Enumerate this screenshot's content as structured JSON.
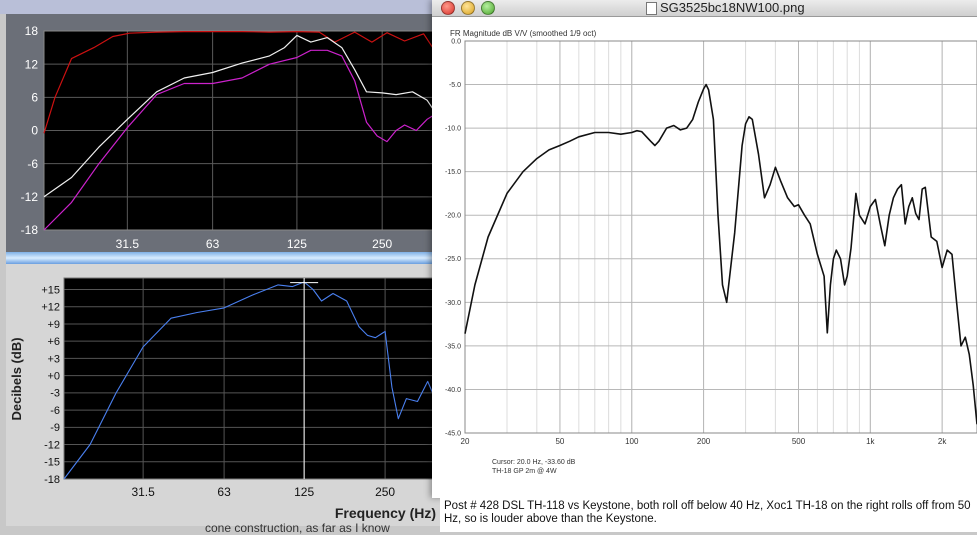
{
  "window": {
    "title": "SG3525bc18NW100.png"
  },
  "caption": "Post # 428 DSL TH-118 vs Keystone, both roll off below 40 Hz, Xoc1 TH-18 on the right rolls off from 50 Hz, so is louder above than the Keystone.",
  "cutoff_text": "cone construction, as far as I know",
  "chart_data": [
    {
      "type": "line",
      "title": "",
      "x_scale": "log",
      "xlim": [
        16,
        400
      ],
      "ylim": [
        -18,
        18
      ],
      "x_ticks": [
        {
          "v": 31.5,
          "label": "31.5"
        },
        {
          "v": 63,
          "label": "63"
        },
        {
          "v": 125,
          "label": "125"
        },
        {
          "v": 250,
          "label": "250"
        }
      ],
      "y_ticks": [
        {
          "v": 18,
          "label": "18"
        },
        {
          "v": 12,
          "label": "12"
        },
        {
          "v": 6,
          "label": "6"
        },
        {
          "v": 0,
          "label": "0"
        },
        {
          "v": -6,
          "label": "-6"
        },
        {
          "v": -12,
          "label": "-12"
        },
        {
          "v": -18,
          "label": "-18"
        }
      ],
      "colors": {
        "red": "#cc1111",
        "white": "#f0f0f0",
        "magenta": "#cc22cc"
      },
      "series": [
        {
          "color": "red",
          "x": [
            16,
            17.5,
            20,
            24,
            28,
            32,
            40,
            50,
            63,
            80,
            100,
            125,
            150,
            170,
            200,
            230,
            260,
            300,
            350,
            400
          ],
          "y": [
            -0.5,
            6,
            13,
            15,
            17,
            17.6,
            17.8,
            17.9,
            17.9,
            17.9,
            17.8,
            17.9,
            17.8,
            16,
            17.8,
            16,
            17.7,
            16.2,
            17.5,
            13
          ]
        },
        {
          "color": "white",
          "x": [
            16,
            20,
            25,
            31.5,
            40,
            50,
            63,
            80,
            100,
            113,
            125,
            140,
            160,
            180,
            200,
            220,
            250,
            280,
            320,
            360,
            400
          ],
          "y": [
            -12,
            -8.5,
            -3,
            2,
            7,
            9.5,
            10.5,
            12.2,
            13.5,
            15,
            17.2,
            16,
            16.8,
            15,
            11,
            7,
            6.8,
            6.5,
            7,
            5.5,
            2
          ]
        },
        {
          "color": "magenta",
          "x": [
            16,
            20,
            25,
            31.5,
            40,
            50,
            63,
            80,
            100,
            125,
            140,
            160,
            180,
            200,
            220,
            240,
            260,
            280,
            300,
            330,
            360,
            400
          ],
          "y": [
            -18,
            -13,
            -6,
            0.5,
            6.5,
            8.5,
            8.5,
            9.5,
            12,
            13.2,
            14.5,
            14.5,
            13.5,
            9,
            1.5,
            -1,
            -2,
            0,
            1,
            0,
            2,
            3.5
          ]
        }
      ]
    },
    {
      "type": "line",
      "title": "",
      "ylabel": "Decibels (dB)",
      "xlabel": "Frequency (Hz)",
      "x_scale": "log",
      "xlim": [
        16,
        400
      ],
      "ylim": [
        -18,
        17
      ],
      "x_ticks": [
        {
          "v": 31.5,
          "label": "31.5"
        },
        {
          "v": 63,
          "label": "63"
        },
        {
          "v": 125,
          "label": "125"
        },
        {
          "v": 250,
          "label": "250"
        }
      ],
      "y_ticks": [
        {
          "v": 15,
          "label": "+15"
        },
        {
          "v": 12,
          "label": "+12"
        },
        {
          "v": 9,
          "label": "+9"
        },
        {
          "v": 6,
          "label": "+6"
        },
        {
          "v": 3,
          "label": "+3"
        },
        {
          "v": 0,
          "label": "+0"
        },
        {
          "v": -3,
          "label": "-3"
        },
        {
          "v": -6,
          "label": "-6"
        },
        {
          "v": -9,
          "label": "-9"
        },
        {
          "v": -12,
          "label": "-12"
        },
        {
          "v": -15,
          "label": "-15"
        },
        {
          "v": -18,
          "label": "-18"
        }
      ],
      "colors": {
        "line": "#4a80f0",
        "marker": "#ffffff"
      },
      "marker": {
        "x": 125,
        "y": 16.2
      },
      "series": [
        {
          "color": "line",
          "x": [
            16,
            20,
            25,
            31.5,
            40,
            50,
            63,
            80,
            100,
            113,
            125,
            135,
            145,
            160,
            180,
            200,
            215,
            230,
            250,
            265,
            280,
            300,
            330,
            360,
            400
          ],
          "y": [
            -18,
            -12,
            -3,
            5,
            10,
            11,
            11.8,
            14,
            15.8,
            15.5,
            16.3,
            15,
            13,
            14.3,
            13,
            8.5,
            7,
            6.6,
            7.7,
            -2,
            -7.5,
            -4,
            -4.5,
            -1,
            -6
          ]
        }
      ]
    },
    {
      "type": "line",
      "title": "FR Magnitude dB V/V (smoothed 1/9 oct)",
      "x_scale": "log",
      "xlim": [
        20,
        2800
      ],
      "ylim": [
        -45,
        0
      ],
      "x_ticks": [
        {
          "v": 20,
          "label": "20"
        },
        {
          "v": 50,
          "label": "50"
        },
        {
          "v": 100,
          "label": "100"
        },
        {
          "v": 200,
          "label": "200"
        },
        {
          "v": 500,
          "label": "500"
        },
        {
          "v": 1000,
          "label": "1k"
        },
        {
          "v": 2000,
          "label": "2k"
        }
      ],
      "y_ticks": [
        {
          "v": 0,
          "label": "0.0"
        },
        {
          "v": -5,
          "label": "-5.0"
        },
        {
          "v": -10,
          "label": "-10.0"
        },
        {
          "v": -15,
          "label": "-15.0"
        },
        {
          "v": -20,
          "label": "-20.0"
        },
        {
          "v": -25,
          "label": "-25.0"
        },
        {
          "v": -30,
          "label": "-30.0"
        },
        {
          "v": -35,
          "label": "-35.0"
        },
        {
          "v": -40,
          "label": "-40.0"
        },
        {
          "v": -45,
          "label": "-45.0"
        }
      ],
      "cursor": "Cursor: 20.0 Hz, -33.60 dB",
      "footer": "TH-18 GP 2m @ 4W",
      "colors": {
        "line": "#111111"
      },
      "series": [
        {
          "color": "line",
          "x": [
            20,
            22,
            25,
            30,
            35,
            40,
            45,
            50,
            55,
            60,
            70,
            80,
            90,
            100,
            105,
            110,
            120,
            125,
            130,
            140,
            150,
            160,
            170,
            180,
            190,
            200,
            205,
            210,
            220,
            230,
            240,
            250,
            270,
            290,
            300,
            310,
            320,
            340,
            360,
            380,
            400,
            420,
            450,
            480,
            500,
            530,
            560,
            600,
            640,
            660,
            680,
            700,
            720,
            750,
            780,
            800,
            830,
            870,
            900,
            950,
            1000,
            1050,
            1100,
            1150,
            1200,
            1250,
            1300,
            1350,
            1400,
            1450,
            1500,
            1550,
            1600,
            1650,
            1700,
            1800,
            1900,
            2000,
            2100,
            2200,
            2300,
            2400,
            2500,
            2600,
            2700,
            2800
          ],
          "y": [
            -33.6,
            -28,
            -22.5,
            -17.5,
            -15,
            -13.5,
            -12.5,
            -12,
            -11.5,
            -11,
            -10.5,
            -10.5,
            -10.7,
            -10.5,
            -10.3,
            -10.4,
            -11.5,
            -12,
            -11.5,
            -10,
            -9.7,
            -10.2,
            -10,
            -9,
            -7,
            -5.5,
            -5,
            -5.6,
            -9,
            -20,
            -28,
            -30,
            -22,
            -12,
            -9.5,
            -8.7,
            -9,
            -13,
            -18,
            -16.5,
            -14.5,
            -16,
            -18,
            -19,
            -18.8,
            -20,
            -21,
            -24.5,
            -27,
            -33.5,
            -28,
            -25,
            -24,
            -25,
            -28,
            -27,
            -23.8,
            -17.5,
            -20,
            -21,
            -19,
            -18.2,
            -21,
            -23.5,
            -20,
            -18,
            -17,
            -16.5,
            -21,
            -19,
            -18,
            -19.8,
            -20.5,
            -17,
            -16.8,
            -22.5,
            -23,
            -26,
            -24,
            -24.5,
            -30,
            -35,
            -34,
            -36,
            -39.5,
            -44
          ]
        }
      ]
    }
  ]
}
